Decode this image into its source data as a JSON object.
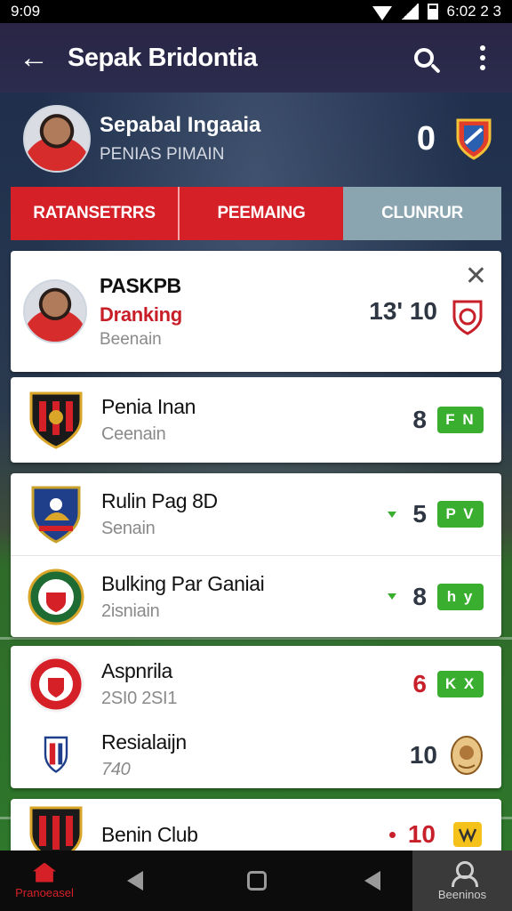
{
  "status_bar": {
    "time": "9:09",
    "right_text": "6:02 2 3"
  },
  "app_bar": {
    "title": "Sepak Bridontia"
  },
  "profile": {
    "name": "Sepabal Ingaaia",
    "subtitle": "PENIAS PIMAIN",
    "score": "0"
  },
  "tabs": [
    {
      "label": "RATANSETRRS"
    },
    {
      "label": "PEEMAING"
    },
    {
      "label": "CLUNRUR"
    }
  ],
  "cards": [
    {
      "rows": [
        {
          "name": "PASKPB",
          "subtitle": "Dranking",
          "subtitle2": "Beenain",
          "number": "13' 10",
          "icon": "player-avatar",
          "end_icon": "shield-s-icon",
          "closable": true
        }
      ]
    },
    {
      "rows": [
        {
          "name": "Penia Inan",
          "subtitle": "Ceenain",
          "number": "8",
          "badge": "F N",
          "icon": "club-crest-red-black"
        }
      ]
    },
    {
      "rows": [
        {
          "name": "Rulin Pag 8D",
          "subtitle": "Senain",
          "number": "5",
          "badge": "P V",
          "icon": "club-crest-blue"
        },
        {
          "name": "Bulking Par Ganiai",
          "subtitle": "2isniain",
          "number": "8",
          "badge": "h y",
          "icon": "club-crest-green"
        }
      ]
    },
    {
      "rows": [
        {
          "name": "Aspnrila",
          "subtitle": "2SI0 2SI1",
          "number": "6",
          "badge": "K X",
          "icon": "club-crest-red-round"
        },
        {
          "name": "Resialaijn",
          "subtitle": "740",
          "number": "10",
          "icon": "club-crest-small-shield",
          "end_icon": "mascot-icon"
        }
      ]
    },
    {
      "rows": [
        {
          "name": "Benin Club",
          "number": "10",
          "icon": "club-crest-red-black",
          "end_icon": "yellow-badge-icon"
        }
      ]
    }
  ],
  "bottom_nav": {
    "home_label": "Pranoeasel",
    "profile_label": "Beeninos"
  },
  "colors": {
    "accent": "#d52028",
    "badge_green": "#3aae2f",
    "tab_inactive": "#8ba5b0"
  }
}
